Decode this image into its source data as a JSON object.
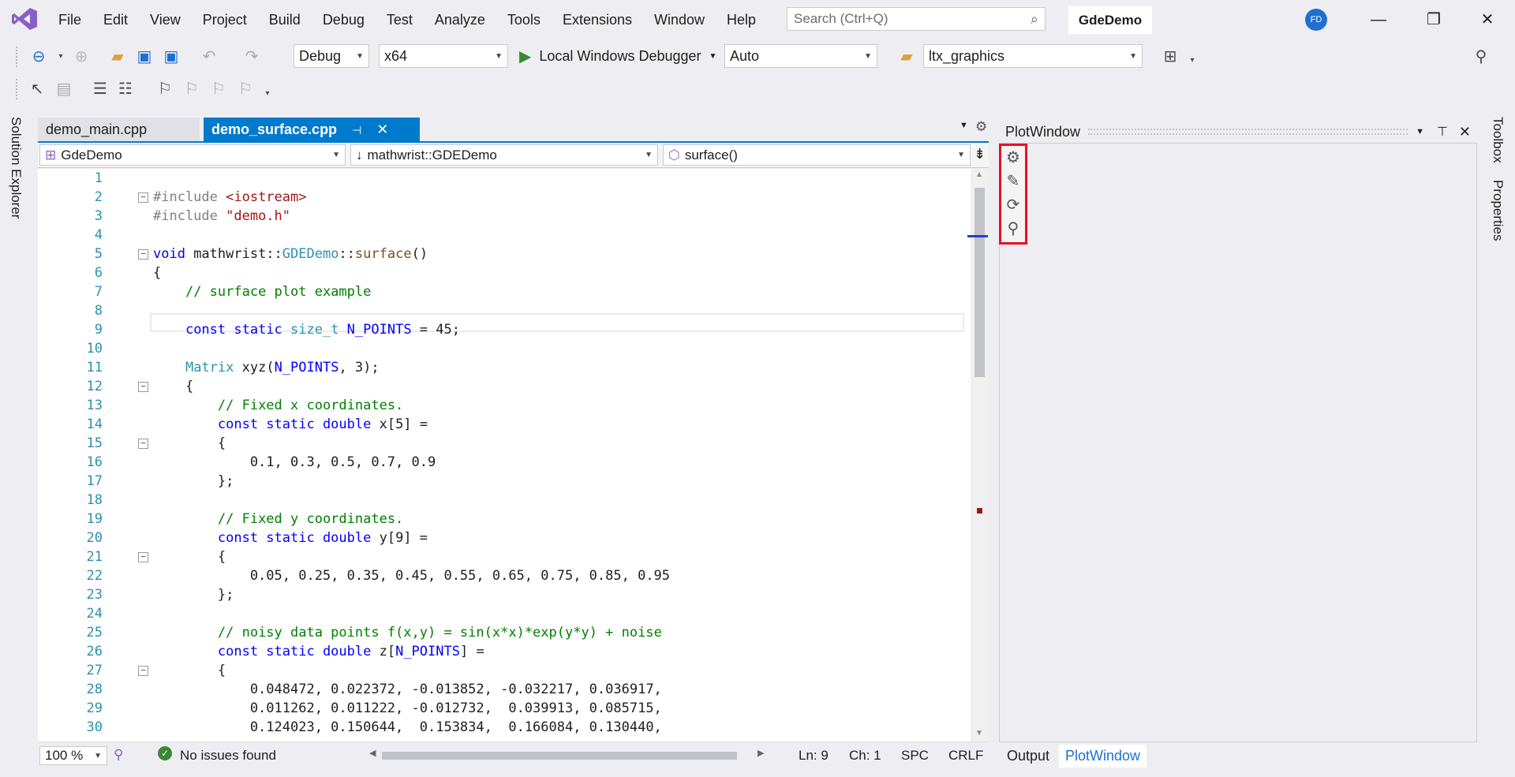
{
  "menu": [
    "File",
    "Edit",
    "View",
    "Project",
    "Build",
    "Debug",
    "Test",
    "Analyze",
    "Tools",
    "Extensions",
    "Window",
    "Help"
  ],
  "search": {
    "placeholder": "Search (Ctrl+Q)"
  },
  "project_name": "GdeDemo",
  "avatar": "FD",
  "toolbar": {
    "config": "Debug",
    "platform": "x64",
    "run_label": "Local Windows Debugger",
    "auto": "Auto",
    "startup_project": "ltx_graphics"
  },
  "side": {
    "left": "Solution Explorer",
    "right_top": "Toolbox",
    "right_bottom": "Properties"
  },
  "tabs": [
    {
      "label": "demo_main.cpp"
    },
    {
      "label": "demo_surface.cpp"
    }
  ],
  "nav": {
    "project": "GdeDemo",
    "scope": "mathwrist::GDEDemo",
    "member": "surface()"
  },
  "status": {
    "zoom": "100 %",
    "issues": "No issues found",
    "line": "Ln: 9",
    "col": "Ch: 1",
    "spc": "SPC",
    "eol": "CRLF"
  },
  "plot": {
    "title": "PlotWindow"
  },
  "bottom_tabs": [
    "Output",
    "PlotWindow"
  ],
  "code": [
    {
      "n": "1",
      "parts": []
    },
    {
      "n": "2",
      "fold": "⊟",
      "parts": [
        [
          "p",
          "#include "
        ],
        [
          "s",
          "<iostream>"
        ]
      ]
    },
    {
      "n": "3",
      "parts": [
        [
          "p",
          "#include "
        ],
        [
          "s",
          "\"demo.h\""
        ]
      ]
    },
    {
      "n": "4",
      "parts": []
    },
    {
      "n": "5",
      "fold": "⊟",
      "parts": [
        [
          "k",
          "void"
        ],
        [
          "",
          " mathwrist::"
        ],
        [
          "t",
          "GDEDemo"
        ],
        [
          "",
          "::"
        ],
        [
          "f",
          "surface"
        ],
        [
          "",
          "()"
        ]
      ]
    },
    {
      "n": "6",
      "parts": [
        [
          "",
          "{"
        ]
      ]
    },
    {
      "n": "7",
      "parts": [
        [
          "",
          "    "
        ],
        [
          "c",
          "// surface plot example"
        ]
      ]
    },
    {
      "n": "8",
      "parts": []
    },
    {
      "n": "9",
      "parts": [
        [
          "",
          "    "
        ],
        [
          "k",
          "const static "
        ],
        [
          "t",
          "size_t "
        ],
        [
          "k",
          "N_POINTS"
        ],
        [
          "",
          " = 45;"
        ]
      ]
    },
    {
      "n": "10",
      "parts": []
    },
    {
      "n": "11",
      "parts": [
        [
          "",
          "    "
        ],
        [
          "t",
          "Matrix "
        ],
        [
          "",
          "xyz("
        ],
        [
          "k",
          "N_POINTS"
        ],
        [
          "",
          ", 3);"
        ]
      ]
    },
    {
      "n": "12",
      "fold": "⊟",
      "parts": [
        [
          "",
          "    {"
        ]
      ]
    },
    {
      "n": "13",
      "parts": [
        [
          "",
          "        "
        ],
        [
          "c",
          "// Fixed x coordinates."
        ]
      ]
    },
    {
      "n": "14",
      "parts": [
        [
          "",
          "        "
        ],
        [
          "k",
          "const static double "
        ],
        [
          "",
          "x[5] ="
        ]
      ]
    },
    {
      "n": "15",
      "fold": "⊟",
      "parts": [
        [
          "",
          "        {"
        ]
      ]
    },
    {
      "n": "16",
      "parts": [
        [
          "",
          "            0.1, 0.3, 0.5, 0.7, 0.9"
        ]
      ]
    },
    {
      "n": "17",
      "parts": [
        [
          "",
          "        };"
        ]
      ]
    },
    {
      "n": "18",
      "parts": []
    },
    {
      "n": "19",
      "parts": [
        [
          "",
          "        "
        ],
        [
          "c",
          "// Fixed y coordinates."
        ]
      ]
    },
    {
      "n": "20",
      "parts": [
        [
          "",
          "        "
        ],
        [
          "k",
          "const static double "
        ],
        [
          "",
          "y[9] ="
        ]
      ]
    },
    {
      "n": "21",
      "fold": "⊟",
      "parts": [
        [
          "",
          "        {"
        ]
      ]
    },
    {
      "n": "22",
      "parts": [
        [
          "",
          "            0.05, 0.25, 0.35, 0.45, 0.55, 0.65, 0.75, 0.85, 0.95"
        ]
      ]
    },
    {
      "n": "23",
      "parts": [
        [
          "",
          "        };"
        ]
      ]
    },
    {
      "n": "24",
      "parts": []
    },
    {
      "n": "25",
      "parts": [
        [
          "",
          "        "
        ],
        [
          "c",
          "// noisy data points f(x,y) = sin(x*x)*exp(y*y) + noise"
        ]
      ]
    },
    {
      "n": "26",
      "parts": [
        [
          "",
          "        "
        ],
        [
          "k",
          "const static double "
        ],
        [
          "",
          "z["
        ],
        [
          "k",
          "N_POINTS"
        ],
        [
          "",
          "] ="
        ]
      ]
    },
    {
      "n": "27",
      "fold": "⊟",
      "parts": [
        [
          "",
          "        {"
        ]
      ]
    },
    {
      "n": "28",
      "parts": [
        [
          "",
          "            0.048472, 0.022372, -0.013852, -0.032217, 0.036917,"
        ]
      ]
    },
    {
      "n": "29",
      "parts": [
        [
          "",
          "            0.011262, 0.011222, -0.012732,  0.039913, 0.085715,"
        ]
      ]
    },
    {
      "n": "30",
      "parts": [
        [
          "",
          "            0.124023, 0.150644,  0.153834,  0.166084, 0.130440,"
        ]
      ]
    }
  ]
}
